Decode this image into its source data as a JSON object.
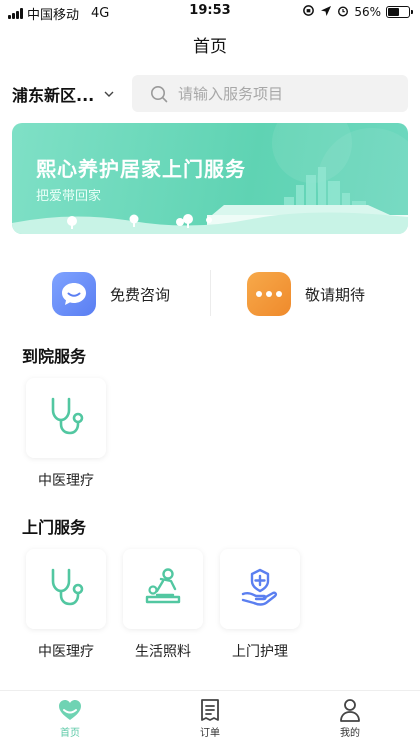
{
  "status_bar": {
    "carrier": "中国移动",
    "network": "4G",
    "time": "19:53",
    "battery_percent": 56,
    "battery_label": "56%"
  },
  "header": {
    "title": "首页"
  },
  "location": {
    "label": "浦东新区..."
  },
  "search": {
    "placeholder": "请输入服务项目"
  },
  "banner": {
    "title": "熙心养护居家上门服务",
    "subtitle": "把爱带回家"
  },
  "quick_actions": [
    {
      "label": "免费咨询",
      "icon": "chat-icon",
      "color": "#6b8ef7"
    },
    {
      "label": "敬请期待",
      "icon": "more-dots-icon",
      "color": "#f39a3b"
    }
  ],
  "sections": [
    {
      "title": "到院服务",
      "items": [
        {
          "label": "中医理疗",
          "icon": "stethoscope-icon"
        }
      ]
    },
    {
      "title": "上门服务",
      "items": [
        {
          "label": "中医理疗",
          "icon": "stethoscope-icon"
        },
        {
          "label": "生活照料",
          "icon": "massage-care-icon"
        },
        {
          "label": "上门护理",
          "icon": "hand-care-icon"
        }
      ]
    }
  ],
  "tabbar": [
    {
      "label": "首页",
      "icon": "heart-home-icon",
      "active": true
    },
    {
      "label": "订单",
      "icon": "order-list-icon",
      "active": false
    },
    {
      "label": "我的",
      "icon": "profile-icon",
      "active": false
    }
  ],
  "colors": {
    "accent": "#5cc9a7",
    "banner": "#6ad6bb",
    "icon_green": "#52c7a1",
    "icon_blue": "#5b7ff0"
  }
}
